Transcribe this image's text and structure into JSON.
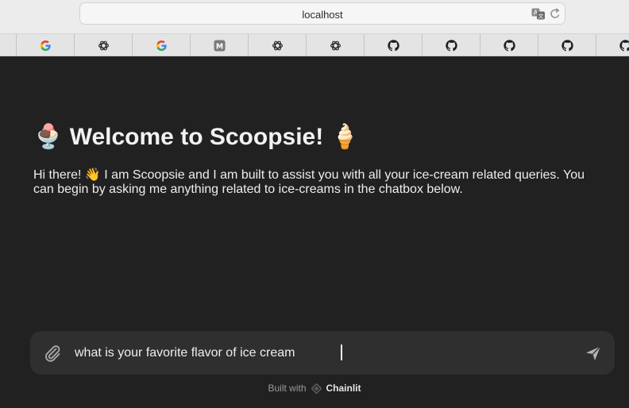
{
  "browser": {
    "url": "localhost",
    "bookmarks": [
      {
        "icon": "google-icon"
      },
      {
        "icon": "openai-icon"
      },
      {
        "icon": "google-icon"
      },
      {
        "icon": "m-icon",
        "letter": "M"
      },
      {
        "icon": "openai-icon"
      },
      {
        "icon": "openai-icon"
      },
      {
        "icon": "github-icon"
      },
      {
        "icon": "github-icon"
      },
      {
        "icon": "github-icon"
      },
      {
        "icon": "github-icon"
      },
      {
        "icon": "github-icon"
      }
    ]
  },
  "welcome": {
    "title_emoji_left": "🍨",
    "title": "Welcome to Scoopsie!",
    "title_emoji_right": "🍦",
    "body": "Hi there! 👋 I am Scoopsie and I am built to assist you with all your ice-cream related queries. You can begin by asking me anything related to ice-creams in the chatbox below."
  },
  "composer": {
    "value": "what is your favorite flavor of ice cream"
  },
  "footer": {
    "prefix": "Built with",
    "brand": "Chainlit"
  },
  "colors": {
    "background": "#212121",
    "composer": "#2f2f2f",
    "text": "#f2f2f2"
  }
}
